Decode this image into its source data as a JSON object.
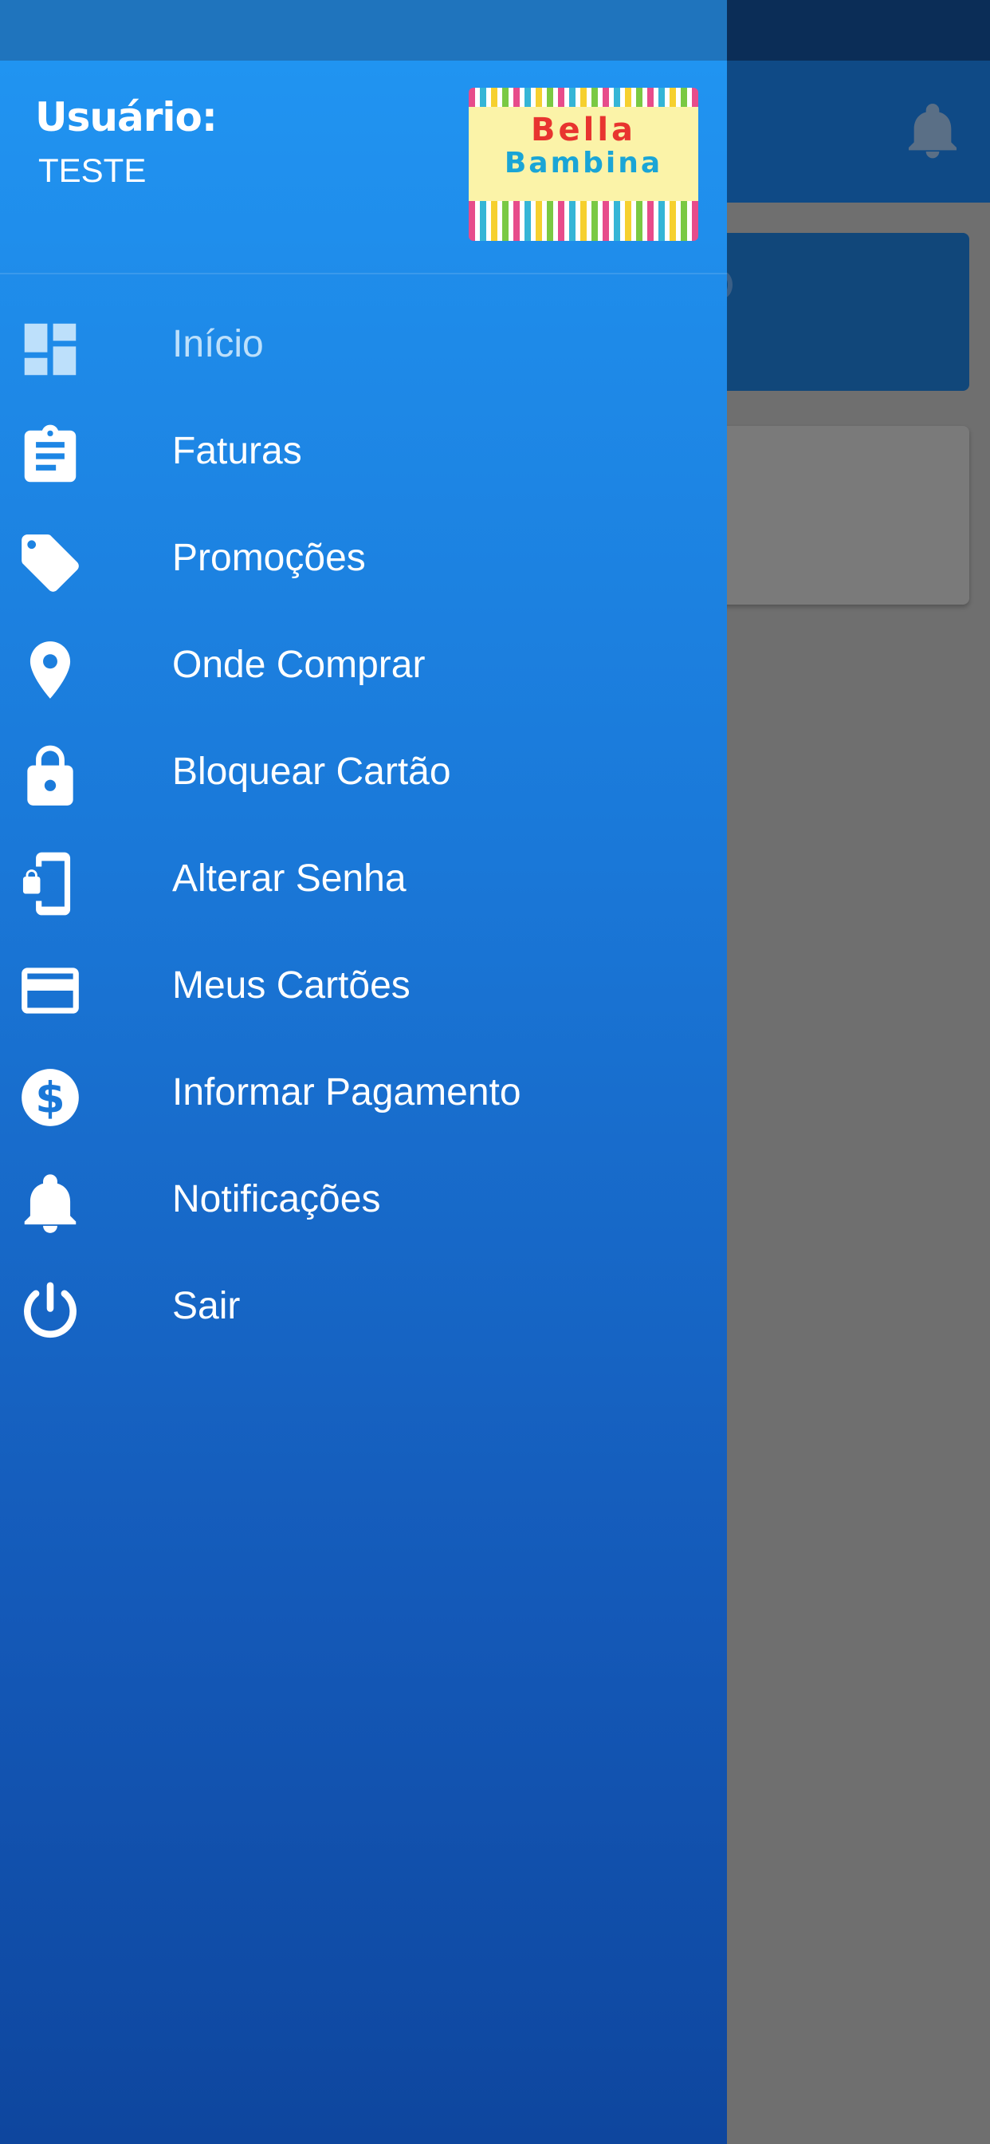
{
  "drawer": {
    "user_label": "Usuário:",
    "user_name": "TESTE",
    "logo": {
      "line1": "Bella",
      "line2": "Bambina"
    },
    "items": [
      {
        "label": "Início",
        "icon": "dashboard-icon",
        "active": true
      },
      {
        "label": "Faturas",
        "icon": "clipboard-icon"
      },
      {
        "label": "Promoções",
        "icon": "tag-icon"
      },
      {
        "label": "Onde Comprar",
        "icon": "location-pin-icon"
      },
      {
        "label": "Bloquear Cartão",
        "icon": "lock-icon"
      },
      {
        "label": "Alterar Senha",
        "icon": "phone-lock-icon"
      },
      {
        "label": "Meus Cartões",
        "icon": "credit-card-icon"
      },
      {
        "label": "Informar Pagamento",
        "icon": "dollar-icon"
      },
      {
        "label": "Notificações",
        "icon": "bell-icon"
      },
      {
        "label": "Sair",
        "icon": "power-icon"
      }
    ]
  },
  "colors": {
    "drawer_top": "#2196f3",
    "drawer_bottom": "#0e469e",
    "active_label": "#bde0fb",
    "scrim": "#6f6f6f"
  }
}
